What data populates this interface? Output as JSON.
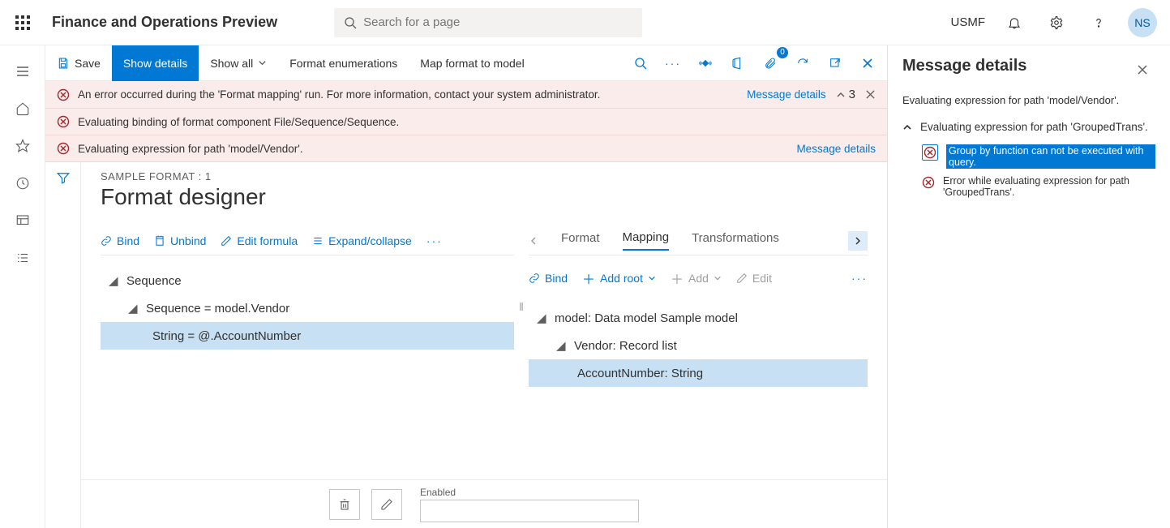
{
  "header": {
    "app_title": "Finance and Operations Preview",
    "search_placeholder": "Search for a page",
    "company": "USMF",
    "avatar_initials": "NS"
  },
  "action_bar": {
    "save": "Save",
    "show_details": "Show details",
    "show_all": "Show all",
    "format_enumerations": "Format enumerations",
    "map_format_to_model": "Map format to model",
    "attachments_count": "0"
  },
  "messages": {
    "m1": "An error occurred during the 'Format mapping' run. For more information, contact your system administrator.",
    "m2": "Evaluating binding of format component File/Sequence/Sequence.",
    "m3": "Evaluating expression for path 'model/Vendor'.",
    "link": "Message details",
    "collapse_count": "3"
  },
  "designer": {
    "breadcrumb": "SAMPLE FORMAT : 1",
    "title": "Format designer",
    "left_toolbar": {
      "bind": "Bind",
      "unbind": "Unbind",
      "edit_formula": "Edit formula",
      "expand_collapse": "Expand/collapse"
    },
    "left_tree": {
      "n0": "Sequence",
      "n1": "Sequence = model.Vendor",
      "n2": "String = @.AccountNumber"
    },
    "right_tabs": {
      "format": "Format",
      "mapping": "Mapping",
      "transformations": "Transformations"
    },
    "right_toolbar": {
      "bind": "Bind",
      "add_root": "Add root",
      "add": "Add",
      "edit": "Edit"
    },
    "right_tree": {
      "n0": "model: Data model Sample model",
      "n1": "Vendor: Record list",
      "n2": "AccountNumber: String"
    },
    "bottom": {
      "enabled_label": "Enabled"
    }
  },
  "right_panel": {
    "title": "Message details",
    "subtitle": "Evaluating expression for path 'model/Vendor'.",
    "group_title": "Evaluating expression for path 'GroupedTrans'.",
    "item1": "Group by function can not be executed with query.",
    "item2": "Error while evaluating expression for path 'GroupedTrans'."
  }
}
